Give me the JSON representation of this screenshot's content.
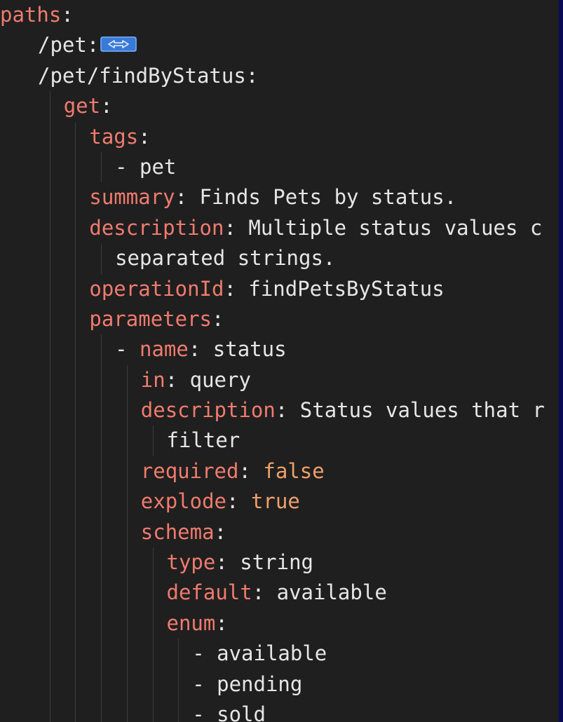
{
  "editor": {
    "lines": [
      {
        "indent": 0,
        "parts": [
          {
            "t": "paths",
            "c": "k"
          },
          {
            "t": ":",
            "c": "v"
          }
        ]
      },
      {
        "indent": 1,
        "parts": [
          {
            "t": "/pet",
            "c": "v"
          },
          {
            "t": ":",
            "c": "v"
          }
        ],
        "folded": true
      },
      {
        "indent": 1,
        "parts": [
          {
            "t": "/pet/findByStatus",
            "c": "v"
          },
          {
            "t": ":",
            "c": "v"
          }
        ]
      },
      {
        "indent": 2,
        "parts": [
          {
            "t": "get",
            "c": "k"
          },
          {
            "t": ":",
            "c": "v"
          }
        ]
      },
      {
        "indent": 3,
        "parts": [
          {
            "t": "tags",
            "c": "k"
          },
          {
            "t": ":",
            "c": "v"
          }
        ]
      },
      {
        "indent": 4,
        "parts": [
          {
            "t": "- pet",
            "c": "v"
          }
        ]
      },
      {
        "indent": 3,
        "parts": [
          {
            "t": "summary",
            "c": "k"
          },
          {
            "t": ": Finds Pets by status.",
            "c": "v"
          }
        ]
      },
      {
        "indent": 3,
        "parts": [
          {
            "t": "description",
            "c": "k"
          },
          {
            "t": ": Multiple status values c",
            "c": "v"
          }
        ]
      },
      {
        "indent": 4,
        "parts": [
          {
            "t": "separated strings.",
            "c": "v"
          }
        ]
      },
      {
        "indent": 3,
        "parts": [
          {
            "t": "operationId",
            "c": "k"
          },
          {
            "t": ": findPetsByStatus",
            "c": "v"
          }
        ]
      },
      {
        "indent": 3,
        "parts": [
          {
            "t": "parameters",
            "c": "k"
          },
          {
            "t": ":",
            "c": "v"
          }
        ]
      },
      {
        "indent": 4,
        "parts": [
          {
            "t": "- ",
            "c": "v"
          },
          {
            "t": "name",
            "c": "k"
          },
          {
            "t": ": status",
            "c": "v"
          }
        ]
      },
      {
        "indent": 5,
        "parts": [
          {
            "t": "in",
            "c": "k"
          },
          {
            "t": ": query",
            "c": "v"
          }
        ]
      },
      {
        "indent": 5,
        "parts": [
          {
            "t": "description",
            "c": "k"
          },
          {
            "t": ": Status values that r",
            "c": "v"
          }
        ]
      },
      {
        "indent": 6,
        "parts": [
          {
            "t": "filter",
            "c": "v"
          }
        ]
      },
      {
        "indent": 5,
        "parts": [
          {
            "t": "required",
            "c": "k"
          },
          {
            "t": ": ",
            "c": "v"
          },
          {
            "t": "false",
            "c": "num"
          }
        ]
      },
      {
        "indent": 5,
        "parts": [
          {
            "t": "explode",
            "c": "k"
          },
          {
            "t": ": ",
            "c": "v"
          },
          {
            "t": "true",
            "c": "num"
          }
        ]
      },
      {
        "indent": 5,
        "parts": [
          {
            "t": "schema",
            "c": "k"
          },
          {
            "t": ":",
            "c": "v"
          }
        ]
      },
      {
        "indent": 6,
        "parts": [
          {
            "t": "type",
            "c": "k"
          },
          {
            "t": ": string",
            "c": "v"
          }
        ]
      },
      {
        "indent": 6,
        "parts": [
          {
            "t": "default",
            "c": "k"
          },
          {
            "t": ": available",
            "c": "v"
          }
        ]
      },
      {
        "indent": 6,
        "parts": [
          {
            "t": "enum",
            "c": "k"
          },
          {
            "t": ":",
            "c": "v"
          }
        ]
      },
      {
        "indent": 7,
        "parts": [
          {
            "t": "- available",
            "c": "v"
          }
        ]
      },
      {
        "indent": 7,
        "parts": [
          {
            "t": "- pending",
            "c": "v"
          }
        ]
      },
      {
        "indent": 7,
        "parts": [
          {
            "t": "- sold",
            "c": "v"
          }
        ]
      }
    ]
  },
  "colors": {
    "key": "#f07b6e",
    "text": "#e6e6e6",
    "literal": "#f0a06a",
    "background": "#1f1f1f",
    "fold_badge": "#2e6bbf"
  },
  "icons": {
    "fold": "ellipsis-fold-icon"
  }
}
